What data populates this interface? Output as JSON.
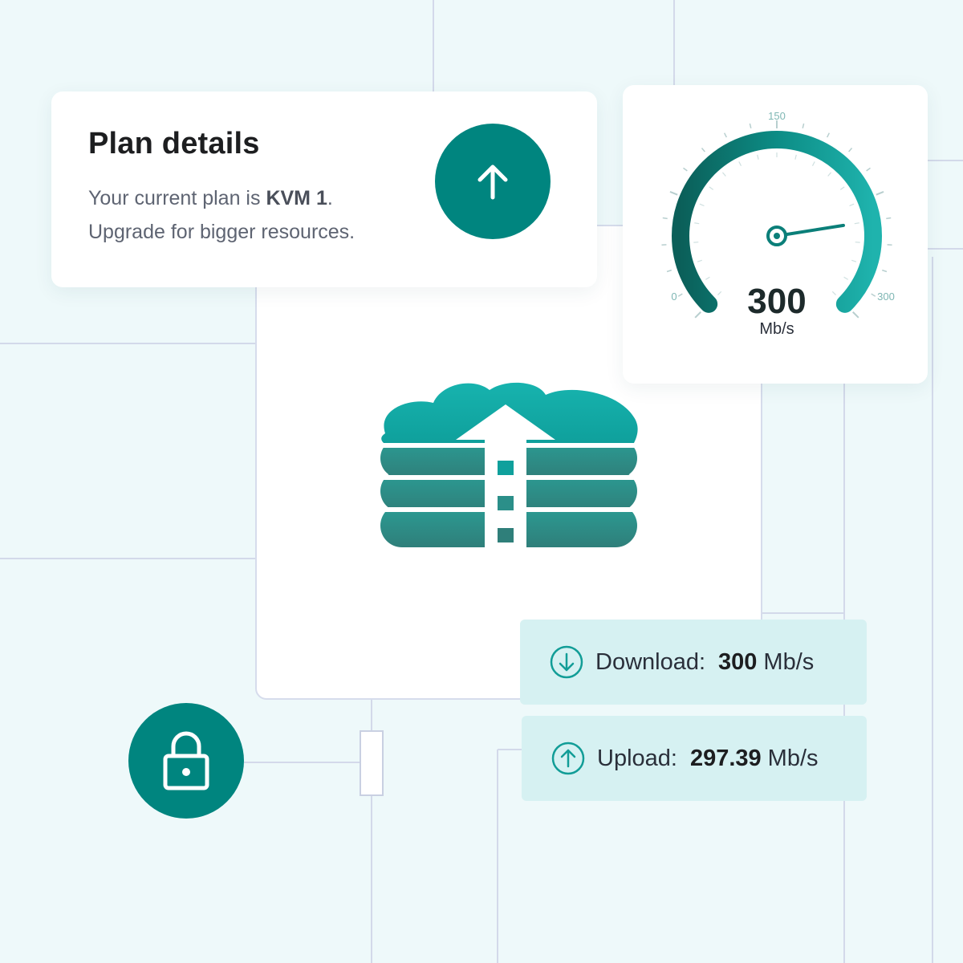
{
  "plan": {
    "title": "Plan details",
    "text_prefix": "Your current plan is ",
    "plan_name": "KVM 1",
    "text_suffix": ".",
    "line2": "Upgrade for bigger resources.",
    "upgrade_icon": "arrow-up-icon"
  },
  "gauge": {
    "value": "300",
    "unit": "Mb/s",
    "tick_min": "0",
    "tick_mid": "150",
    "tick_max": "300",
    "min": 0,
    "max": 300,
    "needle_value": 240
  },
  "speeds": {
    "download": {
      "label": "Download:",
      "value": "300",
      "unit": "Mb/s",
      "icon": "arrow-down-circle-icon"
    },
    "upload": {
      "label": "Upload:",
      "value": "297.39",
      "unit": "Mb/s",
      "icon": "arrow-up-circle-icon"
    }
  },
  "icons": {
    "lock": "lock-icon",
    "cloud": "cloud-database-icon"
  },
  "colors": {
    "accent": "#00857f",
    "accent_light": "#1aadaa",
    "background": "#eef9fa",
    "row_bg": "#d6f1f2"
  }
}
